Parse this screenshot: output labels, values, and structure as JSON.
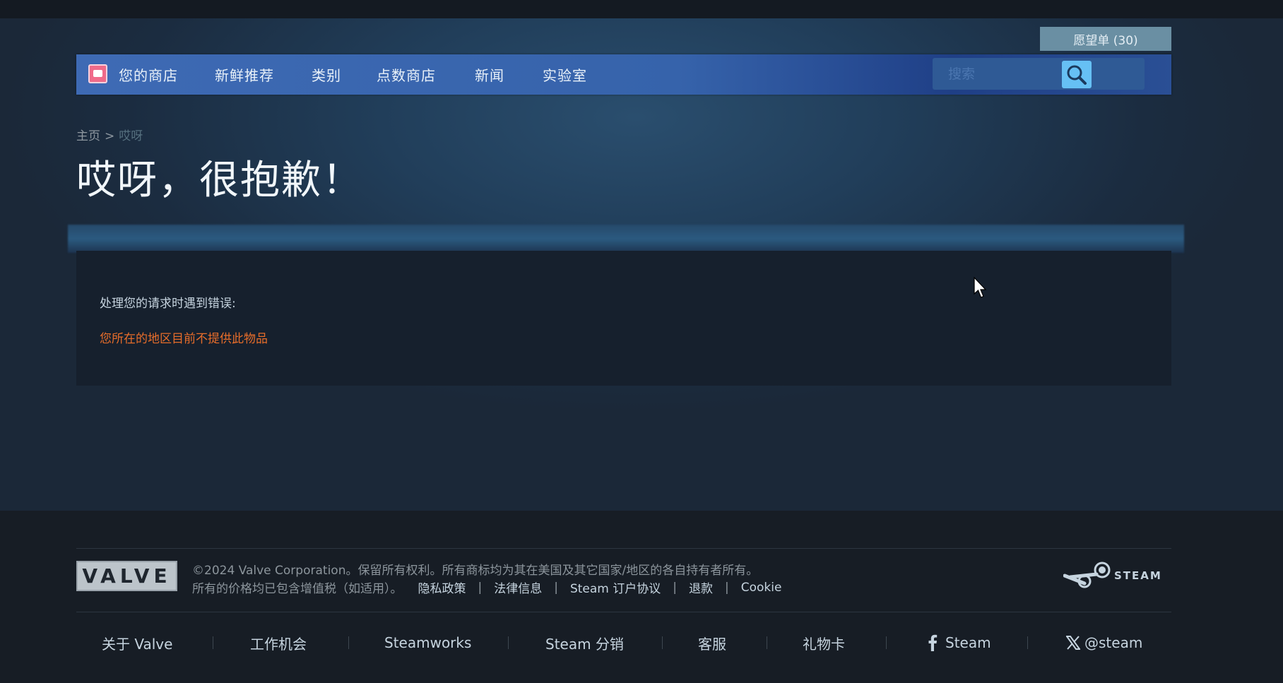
{
  "header": {
    "wishlist_label": "愿望单 (30)",
    "nav": {
      "store": "您的商店",
      "new": "新鲜推荐",
      "categories": "类别",
      "points_shop": "点数商店",
      "news": "新闻",
      "labs": "实验室"
    },
    "search_placeholder": "搜索"
  },
  "breadcrumb": {
    "home": "主页",
    "separator": ">",
    "current": "哎呀"
  },
  "page_title": "哎呀，很抱歉！",
  "error": {
    "label": "处理您的请求时遇到错误:",
    "message": "您所在的地区目前不提供此物品"
  },
  "footer": {
    "valve_logo": "VALVE",
    "copyright": "©2024 Valve Corporation。保留所有权利。所有商标均为其在美国及其它国家/地区的各自持有者所有。",
    "vat_note": "所有的价格均已包含增值税（如适用）。",
    "legal_links": {
      "privacy": "隐私政策",
      "legal": "法律信息",
      "ssa": "Steam 订户协议",
      "refunds": "退款",
      "cookie": "Cookie"
    },
    "steam_logo_text": "STEAM",
    "links": {
      "about_valve": "关于 Valve",
      "jobs": "工作机会",
      "steamworks": "Steamworks",
      "distribution": "Steam 分销",
      "support": "客服",
      "gift_cards": "礼物卡",
      "facebook": "Steam",
      "x": "@steam"
    }
  },
  "colors": {
    "accent_blue": "#66c0f4",
    "error_orange": "#e76d2a",
    "nav_blue": "#3e6ab4"
  }
}
